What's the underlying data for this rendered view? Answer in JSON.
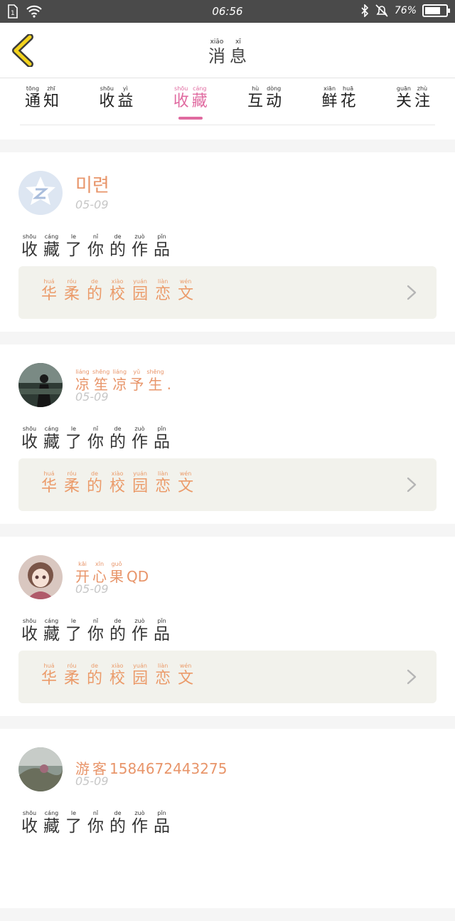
{
  "status_bar": {
    "time": "06:56",
    "battery": "76%",
    "battery_level": 0.76
  },
  "header": {
    "title_pinyin": [
      "xiāo",
      "xī"
    ],
    "title_chars": [
      "消",
      "息"
    ]
  },
  "tabs": [
    {
      "pinyin": [
        "tōng",
        "zhī"
      ],
      "chars": [
        "通",
        "知"
      ],
      "active": false
    },
    {
      "pinyin": [
        "shōu",
        "yì"
      ],
      "chars": [
        "收",
        "益"
      ],
      "active": false
    },
    {
      "pinyin": [
        "shōu",
        "cáng"
      ],
      "chars": [
        "收",
        "藏"
      ],
      "active": true
    },
    {
      "pinyin": [
        "hù",
        "dòng"
      ],
      "chars": [
        "互",
        "动"
      ],
      "active": false
    },
    {
      "pinyin": [
        "xiān",
        "huā"
      ],
      "chars": [
        "鲜",
        "花"
      ],
      "active": false
    },
    {
      "pinyin": [
        "guān",
        "zhù"
      ],
      "chars": [
        "关",
        "注"
      ],
      "active": false
    }
  ],
  "notifications": [
    {
      "username": "미련",
      "username_pinyin": null,
      "avatar": "qq-default-avatar-icon",
      "date": "05-09",
      "action_pinyin": [
        "shōu",
        "cáng",
        "le",
        "nǐ",
        "de",
        "zuò",
        "pǐn"
      ],
      "action_chars": [
        "收",
        "藏",
        "了",
        "你",
        "的",
        "作",
        "品"
      ],
      "work_pinyin": [
        "huá",
        "róu",
        "de",
        "xiào",
        "yuán",
        "liàn",
        "wén"
      ],
      "work_chars": [
        "华",
        "柔",
        "的",
        "校",
        "园",
        "恋",
        "文"
      ]
    },
    {
      "username_chars": [
        "凉",
        "笙",
        "凉",
        "予",
        "生",
        "."
      ],
      "username_pinyin": [
        "liáng",
        "shēng",
        "liáng",
        "yǔ",
        "shēng",
        ""
      ],
      "avatar": "photo-avatar-person",
      "date": "05-09",
      "action_pinyin": [
        "shōu",
        "cáng",
        "le",
        "nǐ",
        "de",
        "zuò",
        "pǐn"
      ],
      "action_chars": [
        "收",
        "藏",
        "了",
        "你",
        "的",
        "作",
        "品"
      ],
      "work_pinyin": [
        "huá",
        "róu",
        "de",
        "xiào",
        "yuán",
        "liàn",
        "wén"
      ],
      "work_chars": [
        "华",
        "柔",
        "的",
        "校",
        "园",
        "恋",
        "文"
      ]
    },
    {
      "username_chars": [
        "开",
        "心",
        "果",
        "QD"
      ],
      "username_pinyin": [
        "kāi",
        "xīn",
        "guǒ",
        ""
      ],
      "avatar": "anime-girl-avatar",
      "date": "05-09",
      "action_pinyin": [
        "shōu",
        "cáng",
        "le",
        "nǐ",
        "de",
        "zuò",
        "pǐn"
      ],
      "action_chars": [
        "收",
        "藏",
        "了",
        "你",
        "的",
        "作",
        "品"
      ],
      "work_pinyin": [
        "huá",
        "róu",
        "de",
        "xiào",
        "yuán",
        "liàn",
        "wén"
      ],
      "work_chars": [
        "华",
        "柔",
        "的",
        "校",
        "园",
        "恋",
        "文"
      ]
    },
    {
      "username_chars": [
        "游",
        "客",
        "1584672443275"
      ],
      "username_pinyin": [
        "",
        "",
        ""
      ],
      "avatar": "landscape-avatar",
      "date": "05-09",
      "action_pinyin": [
        "shōu",
        "cáng",
        "le",
        "nǐ",
        "de",
        "zuò",
        "pǐn"
      ],
      "action_chars": [
        "收",
        "藏",
        "了",
        "你",
        "的",
        "作",
        "品"
      ],
      "work_pinyin": [],
      "work_chars": []
    }
  ],
  "colors": {
    "accent": "#e06aa0",
    "username": "#e8956a",
    "work": "#eb9b6a",
    "back": "#f2d21c"
  }
}
